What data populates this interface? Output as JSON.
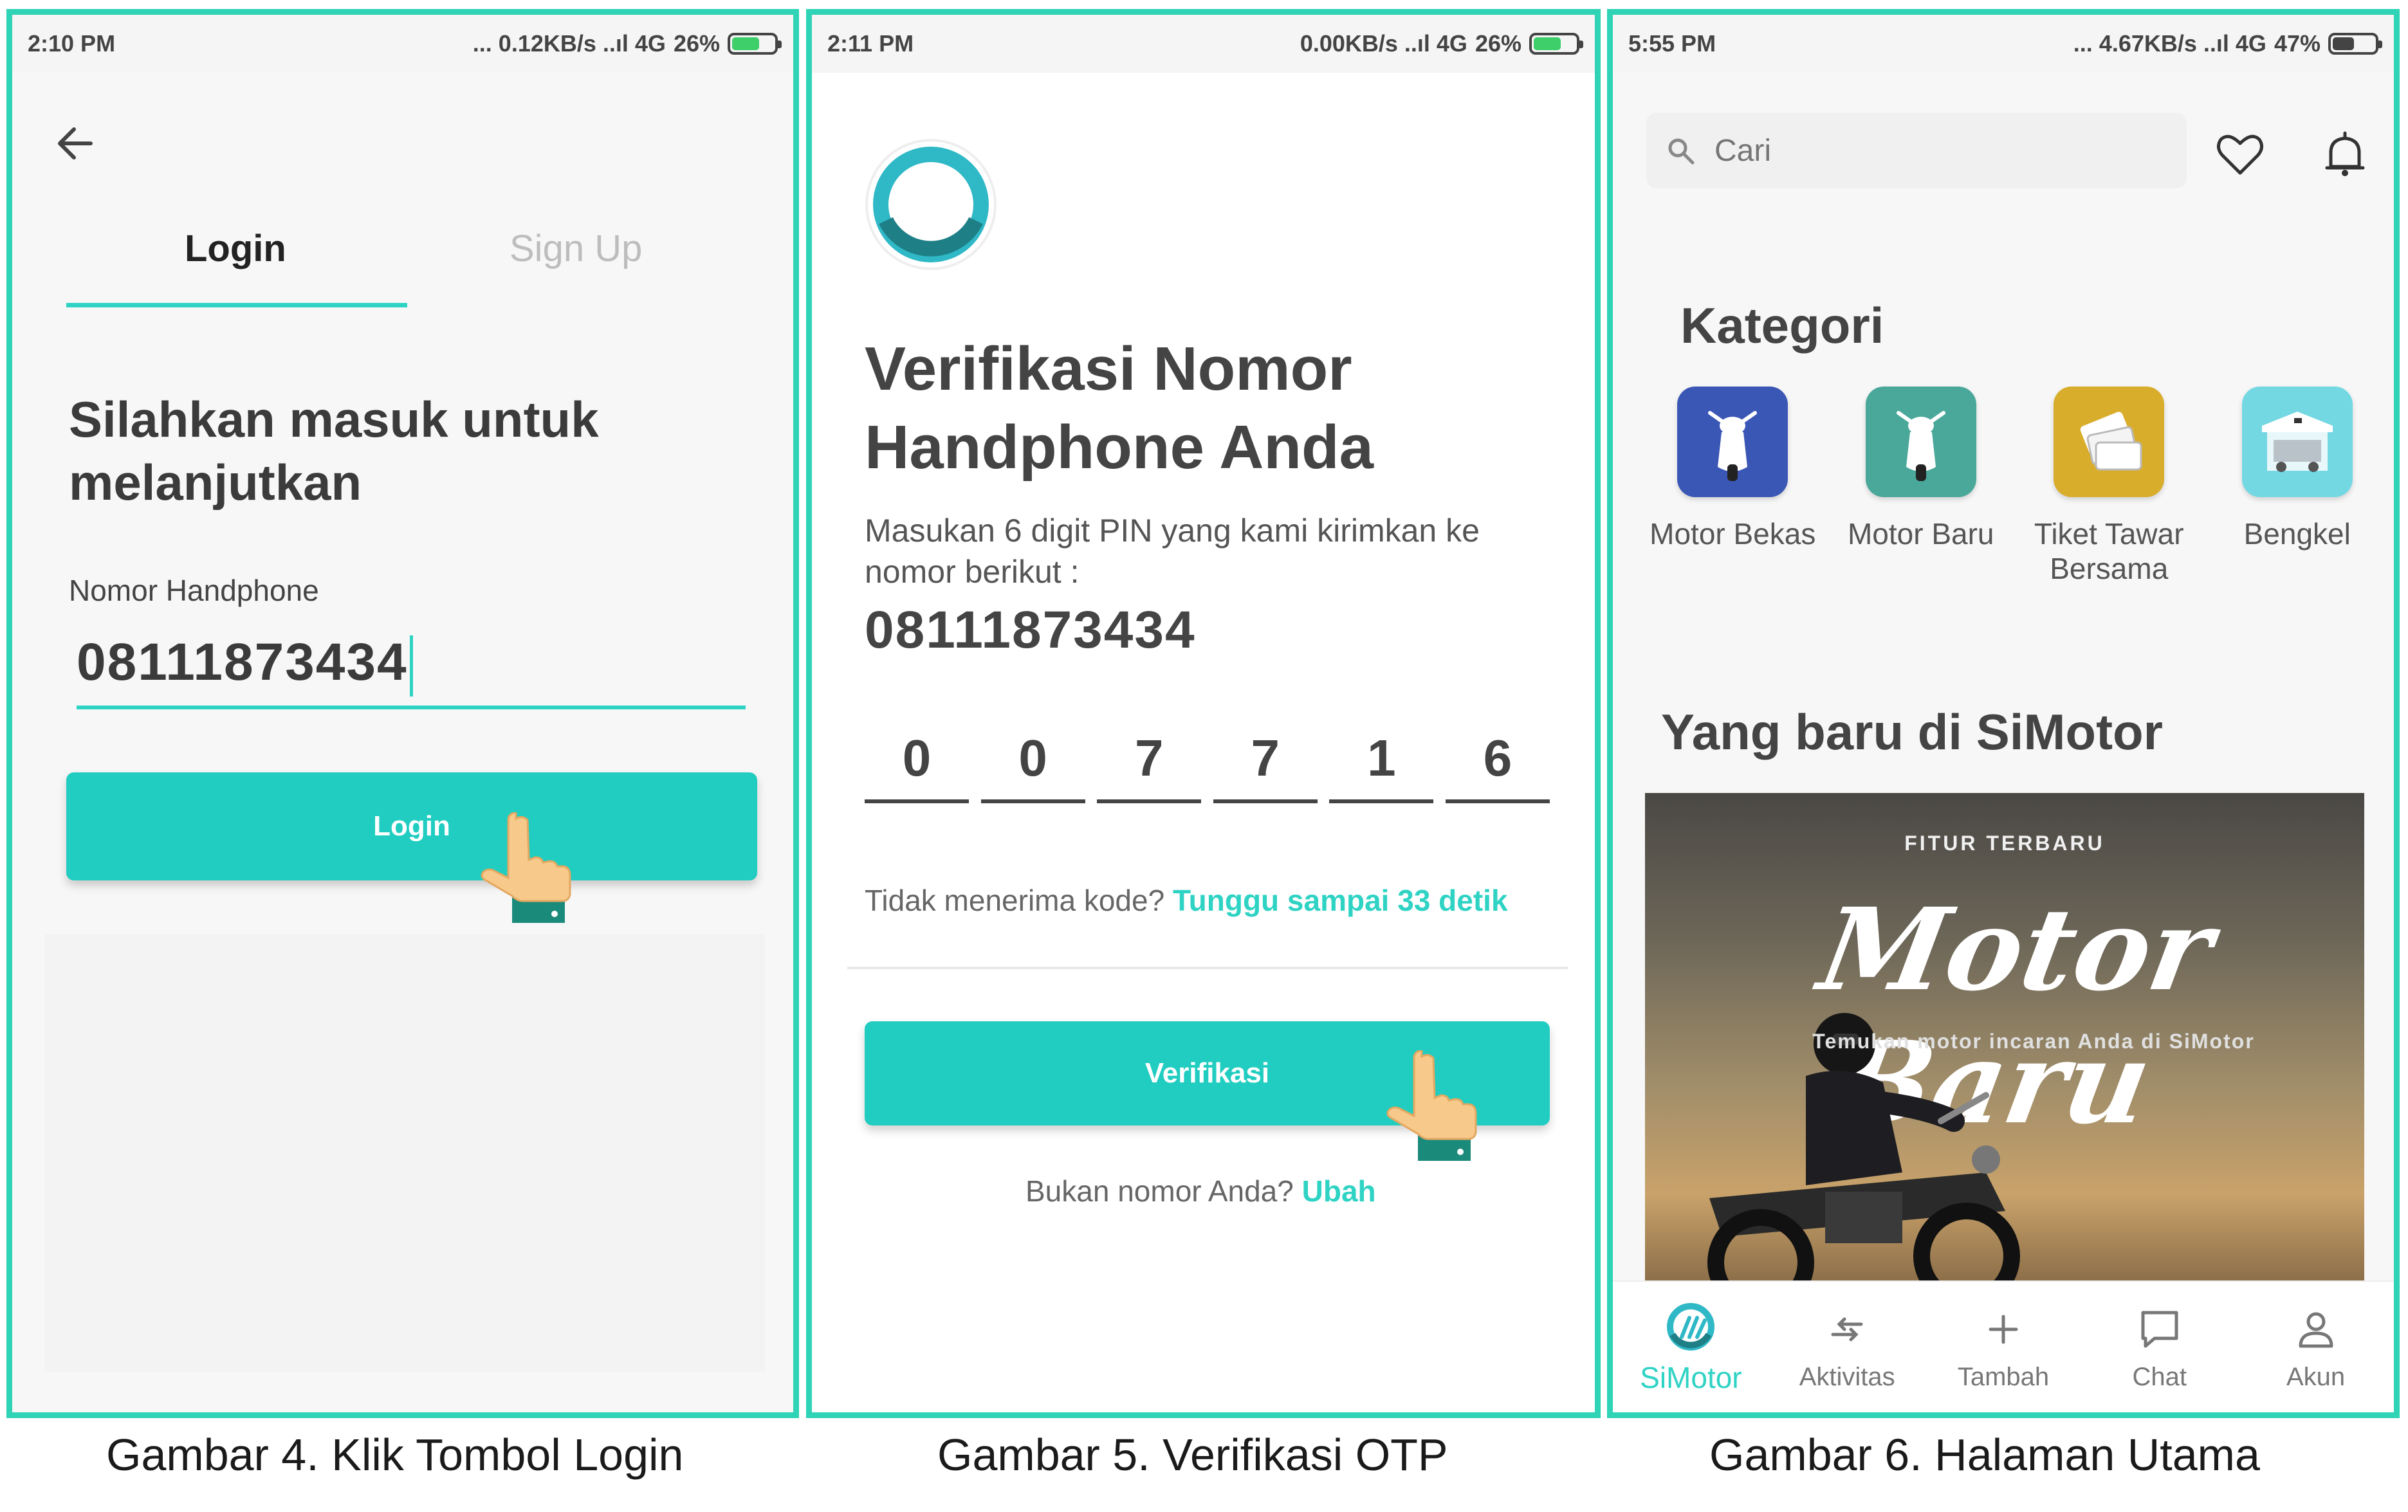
{
  "screen1": {
    "status": {
      "time": "2:10 PM",
      "signal": "... 0.12KB/s ..ıl 4G",
      "battery": "26%"
    },
    "tabs": {
      "login": "Login",
      "signup": "Sign Up"
    },
    "heading": "Silahkan masuk untuk melanjutkan",
    "phone_label": "Nomor Handphone",
    "phone_value": "08111873434",
    "login_button": "Login"
  },
  "screen2": {
    "status": {
      "time": "2:11 PM",
      "signal": "0.00KB/s ..ıl 4G",
      "battery": "26%"
    },
    "title": "Verifikasi Nomor Handphone Anda",
    "description": "Masukan 6 digit PIN yang kami kirimkan ke nomor berikut :",
    "phone_number": "08111873434",
    "otp_digits": [
      "0",
      "0",
      "7",
      "7",
      "1",
      "6"
    ],
    "resend_prefix": "Tidak menerima kode?",
    "resend_wait": "Tunggu sampai 33 detik",
    "verify_button": "Verifikasi",
    "wrong_number_prefix": "Bukan nomor Anda?",
    "change_link": "Ubah"
  },
  "screen3": {
    "status": {
      "time": "5:55 PM",
      "signal": "... 4.67KB/s ..ıl 4G",
      "battery": "47%"
    },
    "search_placeholder": "Cari",
    "category_title": "Kategori",
    "categories": [
      {
        "label": "Motor Bekas",
        "icon": "scooter-icon",
        "color": "#3b57b5"
      },
      {
        "label": "Motor Baru",
        "icon": "scooter-icon",
        "color": "#4aa89a"
      },
      {
        "label": "Tiket Tawar Bersama",
        "icon": "tickets-icon",
        "color": "#d9ad2c"
      },
      {
        "label": "Bengkel",
        "icon": "workshop-icon",
        "color": "#74d8e3"
      }
    ],
    "new_title": "Yang baru di SiMotor",
    "banner": {
      "kicker": "FITUR TERBARU",
      "headline": "Motor Baru",
      "subtitle": "Temukan motor incaran Anda di SiMotor"
    },
    "nav": [
      {
        "label": "SiMotor",
        "icon": "simotor-logo-icon",
        "active": true
      },
      {
        "label": "Aktivitas",
        "icon": "swap-arrows-icon",
        "active": false
      },
      {
        "label": "Tambah",
        "icon": "plus-icon",
        "active": false
      },
      {
        "label": "Chat",
        "icon": "chat-icon",
        "active": false
      },
      {
        "label": "Akun",
        "icon": "user-icon",
        "active": false
      }
    ]
  },
  "captions": {
    "fig4": "Gambar 4. Klik Tombol Login",
    "fig5": "Gambar 5. Verifikasi OTP",
    "fig6": "Gambar 6. Halaman Utama"
  },
  "colors": {
    "accent": "#2fd3c4",
    "frame": "#2fd3b5",
    "battery_charging": "#3fcf6a"
  }
}
